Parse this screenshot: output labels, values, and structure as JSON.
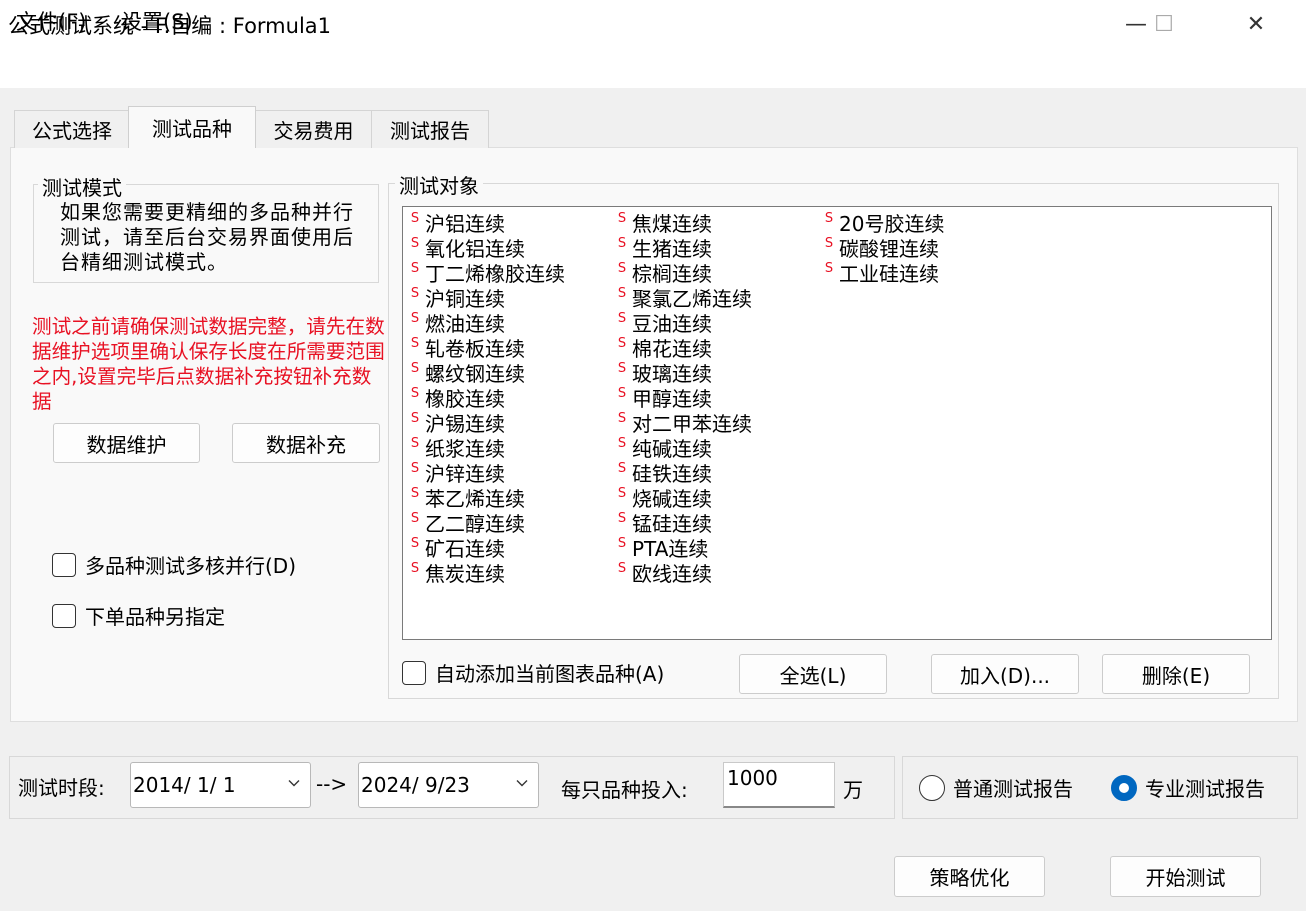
{
  "window": {
    "title": "公式测试系统 - F.自编 : Formula1",
    "minimize_glyph": "—",
    "maximize_glyph": "☐",
    "close_glyph": "✕"
  },
  "menu": {
    "file": "文件(F)",
    "settings": "设置(S)"
  },
  "tabs": [
    {
      "label": "公式选择",
      "active": false
    },
    {
      "label": "测试品种",
      "active": true
    },
    {
      "label": "交易费用",
      "active": false
    },
    {
      "label": "测试报告",
      "active": false
    }
  ],
  "test_mode": {
    "title": "测试模式",
    "text": "如果您需要更精细的多品种并行测试，请至后台交易界面使用后台精细测试模式。"
  },
  "warning": {
    "text": "测试之前请确保测试数据完整，请先在数据维护选项里确认保存长度在所需要范围之内,设置完毕后点数据补充按钮补充数据",
    "color": "#e81123"
  },
  "buttons": {
    "data_maintenance": "数据维护",
    "data_supplement": "数据补充",
    "select_all": "全选(L)",
    "add": "加入(D)...",
    "delete": "删除(E)",
    "optimize": "策略优化",
    "start_test": "开始测试"
  },
  "checkboxes": {
    "multicore": {
      "label": "多品种测试多核并行(D)",
      "checked": false
    },
    "order_symbol": {
      "label": "下单品种另指定",
      "checked": false
    },
    "auto_add": {
      "label": "自动添加当前图表品种(A)",
      "checked": false
    }
  },
  "test_objects": {
    "title": "测试对象",
    "badge": "S",
    "columns": [
      [
        "沪铝连续",
        "氧化铝连续",
        "丁二烯橡胶连续",
        "沪铜连续",
        "燃油连续",
        "轧卷板连续",
        "螺纹钢连续",
        "橡胶连续",
        "沪锡连续",
        "纸浆连续",
        "沪锌连续",
        "苯乙烯连续",
        "乙二醇连续",
        "矿石连续",
        "焦炭连续"
      ],
      [
        "焦煤连续",
        "生猪连续",
        "棕榈连续",
        "聚氯乙烯连续",
        "豆油连续",
        "棉花连续",
        "玻璃连续",
        "甲醇连续",
        "对二甲苯连续",
        "纯碱连续",
        "硅铁连续",
        "烧碱连续",
        "锰硅连续",
        "PTA连续",
        "欧线连续"
      ],
      [
        "20号胶连续",
        "碳酸锂连续",
        "工业硅连续"
      ]
    ]
  },
  "period": {
    "label": "测试时段:",
    "start": "2014/ 1/ 1",
    "arrow": "-->",
    "end": "2024/ 9/23"
  },
  "investment": {
    "label": "每只品种投入:",
    "value": "1000",
    "unit": "万"
  },
  "report_type": {
    "normal": {
      "label": "普通测试报告",
      "selected": false
    },
    "professional": {
      "label": "专业测试报告",
      "selected": true
    },
    "accent": "#0067c0"
  }
}
